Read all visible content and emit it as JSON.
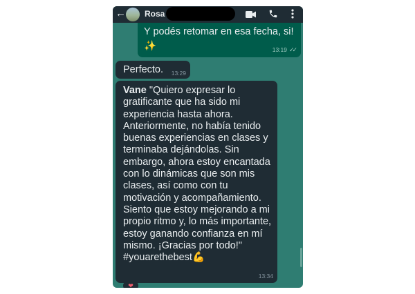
{
  "header": {
    "back_icon": "arrow-left-icon",
    "contact_name": "Rosa",
    "video_icon": "video-camera-icon",
    "call_icon": "phone-icon",
    "menu_icon": "more-vert-icon"
  },
  "messages": [
    {
      "direction": "outgoing",
      "text": "Y podés retomar en esa fecha, si! ✨",
      "time": "13:19",
      "status": "read"
    },
    {
      "direction": "incoming",
      "text": "Perfecto.",
      "time": "13:29"
    },
    {
      "direction": "incoming",
      "author": "Vane",
      "text": "\"Quiero expresar lo gratificante que ha sido mi experiencia hasta ahora. Anteriormente, no había tenido buenas experiencias en clases y terminaba dejándolas. Sin embargo, ahora estoy encantada con lo dinámicas que son mis clases, así como con tu motivación y acompañamiento. Siento que estoy mejorando a mi propio ritmo y, lo más importante, estoy ganando confianza en mí mismo. ¡Gracias por todo!\" #youarethebest💪",
      "time": "13:34",
      "reaction": "❤"
    }
  ],
  "colors": {
    "chat_background": "#2f7d72",
    "incoming_bubble": "#1f2c34",
    "outgoing_bubble": "#005c4b",
    "text": "#e9edef"
  }
}
